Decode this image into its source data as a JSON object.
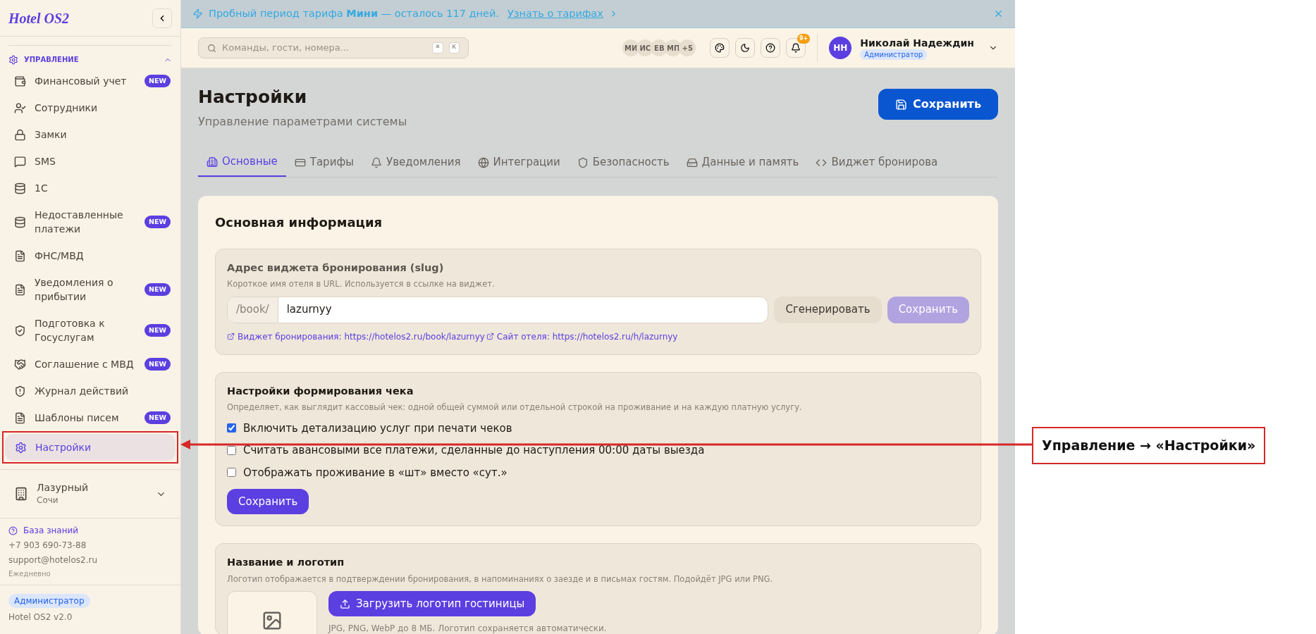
{
  "sidebar": {
    "logo": "Hotel OS2",
    "section": {
      "title": "УПРАВЛЕНИЕ",
      "expanded": true
    },
    "items": [
      {
        "label": "Финансовый учет",
        "badge": "NEW",
        "selected": false
      },
      {
        "label": "Сотрудники",
        "selected": false
      },
      {
        "label": "Замки",
        "selected": false
      },
      {
        "label": "SMS",
        "selected": false
      },
      {
        "label": "1С",
        "selected": false
      },
      {
        "label": "Недоставленные платежи",
        "badge": "NEW",
        "selected": false
      },
      {
        "label": "ФНС/МВД",
        "selected": false
      },
      {
        "label": "Уведомления о прибытии",
        "badge": "NEW",
        "selected": false
      },
      {
        "label": "Подготовка к Госуслугам",
        "badge": "NEW",
        "selected": false
      },
      {
        "label": "Соглашение с МВД",
        "badge": "NEW",
        "selected": false
      },
      {
        "label": "Журнал действий",
        "selected": false
      },
      {
        "label": "Шаблоны писем",
        "badge": "NEW",
        "selected": false
      },
      {
        "label": "Настройки",
        "selected": true
      }
    ],
    "hotel": {
      "name": "Лазурный",
      "city": "Сочи"
    },
    "help": {
      "link": "База знаний",
      "phone": "+7 903 690-73-88",
      "email": "support@hotelos2.ru",
      "hours": "Ежедневно"
    },
    "role": "Администратор",
    "version": "Hotel OS2 v2.0"
  },
  "banner": {
    "text": "Пробный период тарифа **Мини** — осталось 117 дней.",
    "link": "Узнать о тарифах"
  },
  "topbar": {
    "search_placeholder": "Команды, гости, номера...",
    "keys": [
      "⌘",
      "K"
    ],
    "avatars": [
      "МИ",
      "ИС",
      "ЕВ",
      "МП"
    ],
    "more": "+5",
    "notifications": "9+",
    "user": {
      "initials": "НН",
      "name": "Николай Надеждин",
      "role": "Администратор"
    }
  },
  "page": {
    "title": "Настройки",
    "subtitle": "Управление параметрами системы",
    "save": "Сохранить",
    "tabs": [
      {
        "label": "Основные",
        "selected": true
      },
      {
        "label": "Тарифы",
        "selected": false
      },
      {
        "label": "Уведомления",
        "selected": false
      },
      {
        "label": "Интеграции",
        "selected": false
      },
      {
        "label": "Безопасность",
        "selected": false
      },
      {
        "label": "Данные и память",
        "selected": false
      },
      {
        "label": "Виджет бронирова",
        "selected": false
      }
    ],
    "card_title": "Основная информация",
    "slug": {
      "title": "Адрес виджета бронирования (slug)",
      "hint": "Короткое имя отеля в URL. Используется в ссылке на виджет.",
      "prefix": "/book/",
      "value": "lazurnyy",
      "generate": "Сгенерировать",
      "save": "Сохранить",
      "save_disabled": true,
      "links": [
        "Виджет бронирования: https://hotelos2.ru/book/lazurnyy",
        "Сайт отеля: https://hotelos2.ru/h/lazurnyy"
      ]
    },
    "receipt": {
      "title": "Настройки формирования чека",
      "hint": "Определяет, как выглядит кассовый чек: одной общей суммой или отдельной строкой на проживание и на каждую платную услугу.",
      "options": [
        {
          "label": "Включить детализацию услуг при печати чеков",
          "checked": true
        },
        {
          "label": "Считать авансовыми все платежи, сделанные до наступления 00:00 даты выезда",
          "checked": false
        },
        {
          "label": "Отображать проживание в «шт» вместо «сут.»",
          "checked": false
        }
      ],
      "save": "Сохранить"
    },
    "logo": {
      "title": "Название и логотип",
      "hint": "Логотип отображается в подтверждении бронирования, в напоминаниях о заезде и в письмах гостям. Подойдёт JPG или PNG.",
      "upload": "Загрузить логотип гостиницы",
      "note": "JPG, PNG, WebP до 8 МБ. Логотип сохраняется автоматически."
    }
  },
  "annotation": {
    "label": "Управление → «Настройки»"
  }
}
